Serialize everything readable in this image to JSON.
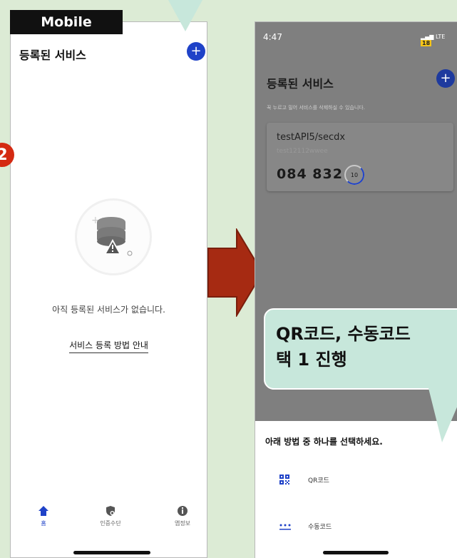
{
  "labels": {
    "mobile": "Mobile",
    "step_badge": "2"
  },
  "left": {
    "title": "등록된 서비스",
    "add_glyph": "+",
    "empty_message": "아직 등록된 서비스가 없습니다.",
    "guide_link": "서비스 등록 방법 안내",
    "nav": [
      {
        "label": "홈",
        "icon": "home-icon",
        "active": true
      },
      {
        "label": "인증수단",
        "icon": "shield-icon",
        "active": false
      },
      {
        "label": "앱정보",
        "icon": "info-icon",
        "active": false
      }
    ]
  },
  "right": {
    "status_time": "4:47",
    "status_network": "LTE",
    "battery": "18",
    "title": "등록된 서비스",
    "subtitle": "꾹 누르고 밀어 서비스를 삭제하실 수 있습니다.",
    "card": {
      "service_name": "testAPI5/secdx",
      "account": "test12112wwee",
      "otp_code": "084 832",
      "timer": "10"
    },
    "sheet_title": "아래 방법 중 하나를 선택하세요.",
    "options": [
      {
        "label": "QR코드",
        "icon": "qr-icon"
      },
      {
        "label": "수동코드",
        "icon": "keypad-icon"
      }
    ]
  },
  "callout": {
    "line1": "QR코드, 수동코드",
    "line2": "택 1 진행"
  },
  "colors": {
    "accent": "#1f42c8",
    "callout": "#c7e7db",
    "arrow": "#a62a12",
    "badge": "#d42a12",
    "background": "#dcebd5"
  }
}
